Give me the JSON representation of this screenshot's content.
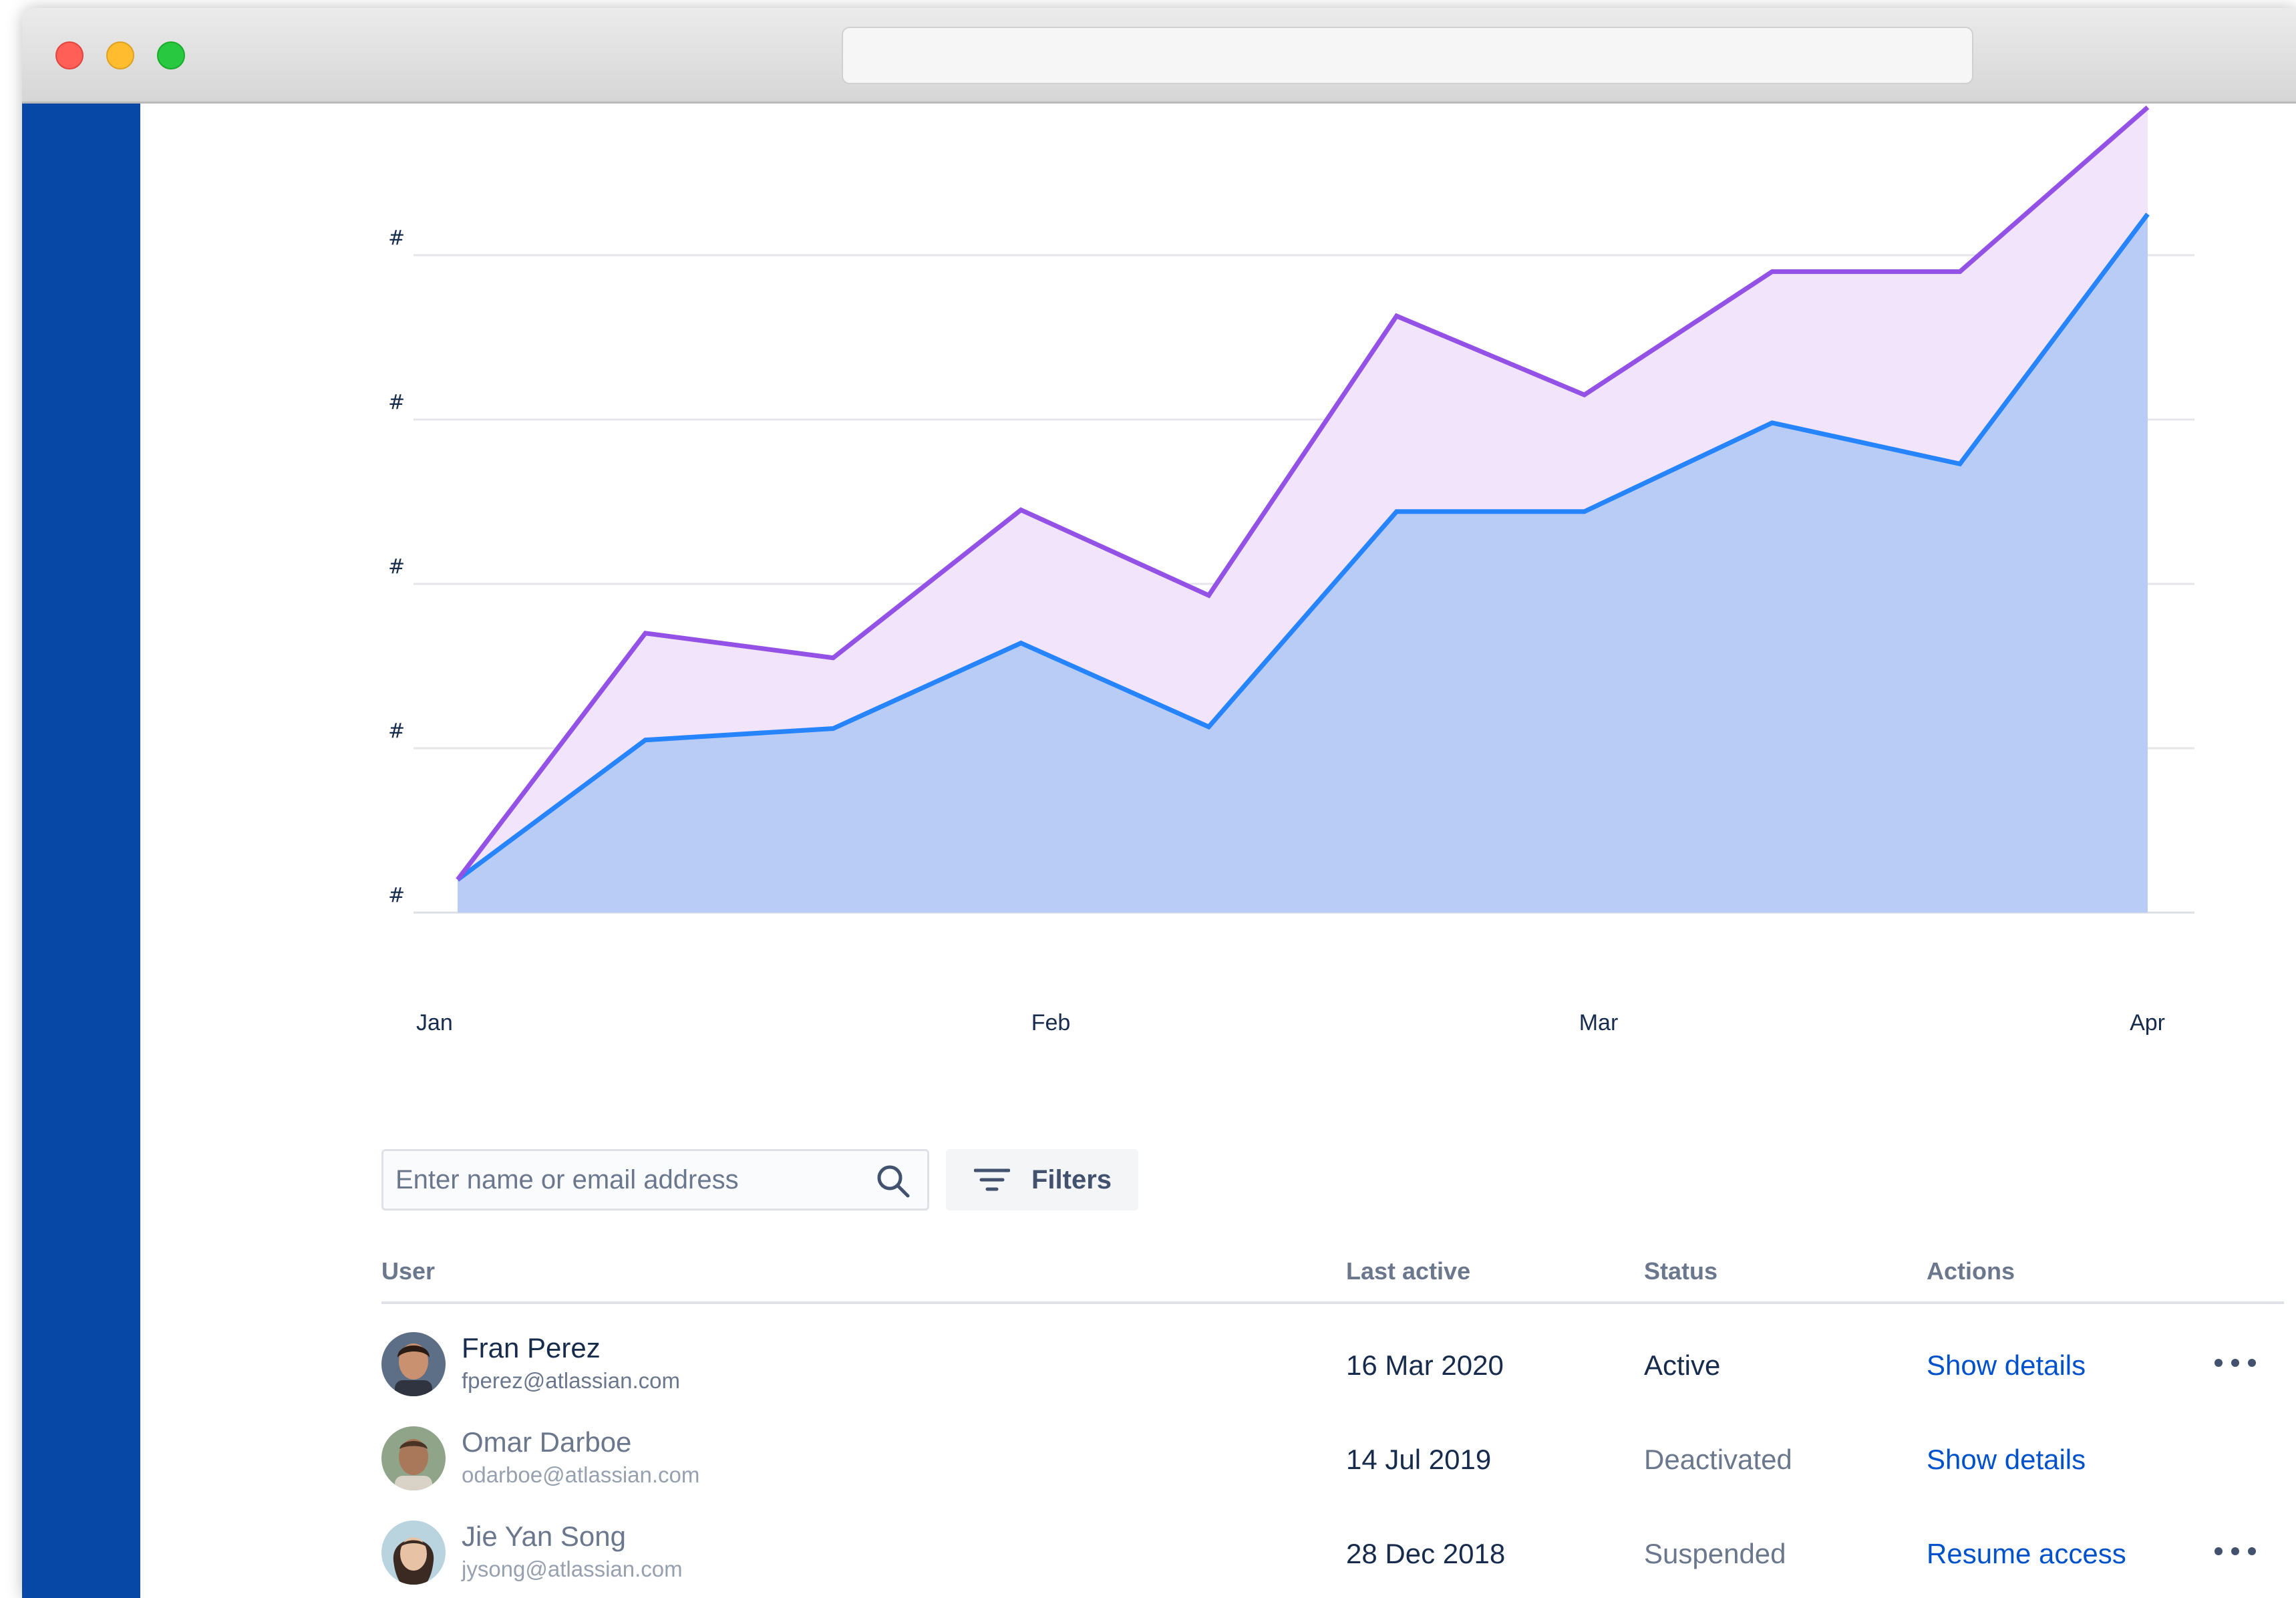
{
  "window": {
    "address_bar": ""
  },
  "colors": {
    "sidebar": "#0747a6",
    "series_top": "#9351e6",
    "series_top_fill": "#f1e4fb",
    "series_bottom": "#2684ff",
    "series_bottom_fill": "#b8ccf5",
    "link": "#0052cc"
  },
  "chart_data": {
    "type": "area",
    "y_tick_labels": [
      "#",
      "#",
      "#",
      "#",
      "#"
    ],
    "x_tick_labels": [
      "Jan",
      "Feb",
      "Mar",
      "Apr"
    ],
    "grid": true,
    "ylim": [
      0,
      5
    ],
    "series": [
      {
        "values": [
          0.2,
          1.7,
          1.55,
          2.45,
          1.93,
          3.63,
          3.15,
          3.9,
          3.9,
          4.9
        ]
      },
      {
        "values": [
          0.2,
          1.05,
          1.12,
          1.64,
          1.13,
          2.44,
          2.44,
          2.98,
          2.73,
          4.25
        ]
      }
    ]
  },
  "search": {
    "placeholder": "Enter name or email address",
    "icon": "search-icon"
  },
  "filters": {
    "label": "Filters",
    "icon": "filter-icon"
  },
  "table": {
    "headers": {
      "user": "User",
      "last_active": "Last active",
      "status": "Status",
      "actions": "Actions"
    },
    "rows": [
      {
        "name": "Fran Perez",
        "email": "fperez@atlassian.com",
        "last_active": "16 Mar 2020",
        "status": "Active",
        "action": "Show details",
        "has_more_menu": true
      },
      {
        "name": "Omar Darboe",
        "email": "odarboe@atlassian.com",
        "last_active": "14 Jul 2019",
        "status": "Deactivated",
        "action": "Show details",
        "has_more_menu": false
      },
      {
        "name": "Jie Yan Song",
        "email": "jysong@atlassian.com",
        "last_active": "28 Dec 2018",
        "status": "Suspended",
        "action": "Resume access",
        "has_more_menu": true
      }
    ]
  }
}
